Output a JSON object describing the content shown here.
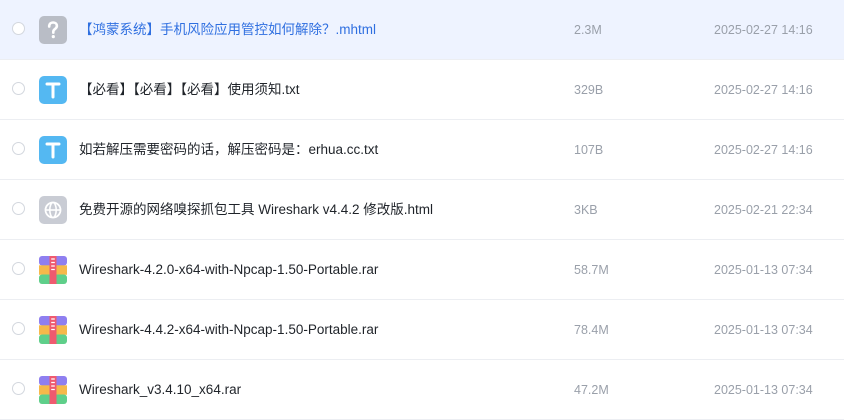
{
  "colors": {
    "hover_bg": "#eef3ff",
    "link_blue": "#2f6fe0",
    "text_icon_bg": "#54b8f2",
    "meta_gray": "#9aa0aa"
  },
  "files": [
    {
      "icon": "unknown-file-icon",
      "name": "【鸿蒙系统】手机风险应用管控如何解除？.mhtml",
      "size": "2.3M",
      "date": "2025-02-27 14:16"
    },
    {
      "icon": "text-file-icon",
      "name": "【必看】【必看】【必看】使用须知.txt",
      "size": "329B",
      "date": "2025-02-27 14:16"
    },
    {
      "icon": "text-file-icon",
      "name": "如若解压需要密码的话，解压密码是：erhua.cc.txt",
      "size": "107B",
      "date": "2025-02-27 14:16"
    },
    {
      "icon": "web-file-icon",
      "name": "免费开源的网络嗅探抓包工具 Wireshark v4.4.2 修改版.html",
      "size": "3KB",
      "date": "2025-02-21 22:34"
    },
    {
      "icon": "archive-file-icon",
      "name": "Wireshark-4.2.0-x64-with-Npcap-1.50-Portable.rar",
      "size": "58.7M",
      "date": "2025-01-13 07:34"
    },
    {
      "icon": "archive-file-icon",
      "name": "Wireshark-4.4.2-x64-with-Npcap-1.50-Portable.rar",
      "size": "78.4M",
      "date": "2025-01-13 07:34"
    },
    {
      "icon": "archive-file-icon",
      "name": "Wireshark_v3.4.10_x64.rar",
      "size": "47.2M",
      "date": "2025-01-13 07:34"
    }
  ]
}
